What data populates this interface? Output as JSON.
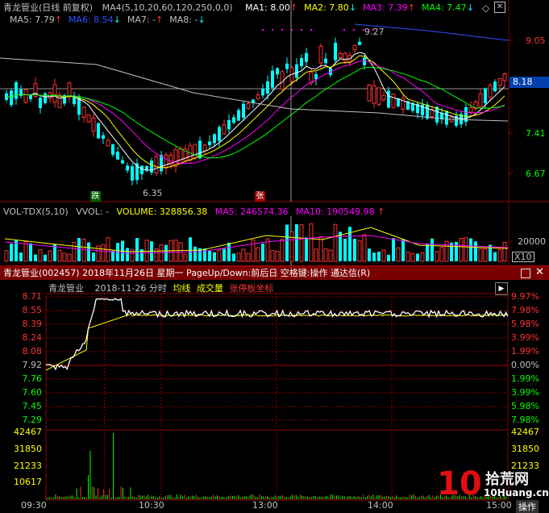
{
  "kline": {
    "title": "青龙管业(日线 前复权)",
    "params": "MA4(5,10,20,60,120,250,0,0)",
    "ma_line1": [
      {
        "label": "MA1: 8.00",
        "color": "#ffffff"
      },
      {
        "label": "MA2: 7.80",
        "color": "#ffff00"
      },
      {
        "label": "MA3: 7.39",
        "color": "#ff00ff"
      },
      {
        "label": "MA4: 7.47",
        "color": "#00ff00"
      }
    ],
    "ma_line2": [
      {
        "label": "MA5: 7.79",
        "color": "#c0c0c0"
      },
      {
        "label": "MA6: 8.54",
        "color": "#3050ff"
      },
      {
        "label": "MA7: -",
        "color": "#c0c0c0"
      },
      {
        "label": "MA8: -",
        "color": "#c0c0c0"
      }
    ],
    "price_axis": [
      "9.05",
      "8.18",
      "7.41",
      "6.67"
    ],
    "current_price": "8.18",
    "high_mark": "9.27",
    "low_mark": "6.35",
    "down_tag": "跌",
    "up_tag": "张"
  },
  "volume": {
    "title": "VOL-TDX(5,10)",
    "vvol": "VVOL: -",
    "volume_label": "VOLUME: 328856.38",
    "ma5_label": "MA5: 246574.36",
    "ma10_label": "MA10: 190549.98",
    "axis_value": "20000",
    "unit": "X10"
  },
  "window": {
    "title": "青龙管业(002457)  2018年11月26日 星期一 PageUp/Down:前后日 空格键:操作 通达信(R)"
  },
  "intraday": {
    "name": "青龙管业",
    "date_label": "2018-11-26 分时",
    "avg_label": "均线",
    "vol_label": "成交量",
    "limit_label": "张停板坐标",
    "left_axis": [
      "8.71",
      "8.55",
      "8.39",
      "8.24",
      "8.08",
      "7.92",
      "7.76",
      "7.60",
      "7.45",
      "7.29"
    ],
    "right_axis": [
      "9.97%",
      "7.98%",
      "5.98%",
      "3.99%",
      "1.99%",
      "0.00%",
      "1.99%",
      "3.99%",
      "5.98%",
      "7.98%"
    ],
    "vol_axis_left": [
      "42467",
      "31850",
      "21233",
      "10617"
    ],
    "vol_axis_right": [
      "42467",
      "31850",
      "21233"
    ],
    "time_axis": [
      "09:30",
      "10:30",
      "13:00",
      "14:00",
      "15:00"
    ],
    "op_label": "操作"
  },
  "watermark": {
    "digits": "10",
    "cn": "拾荒网",
    "url": "10Huang.cn"
  },
  "colors": {
    "up": "#ff3232",
    "down": "#00ffff",
    "grid": "#8b0000",
    "yellow": "#ffff00"
  }
}
